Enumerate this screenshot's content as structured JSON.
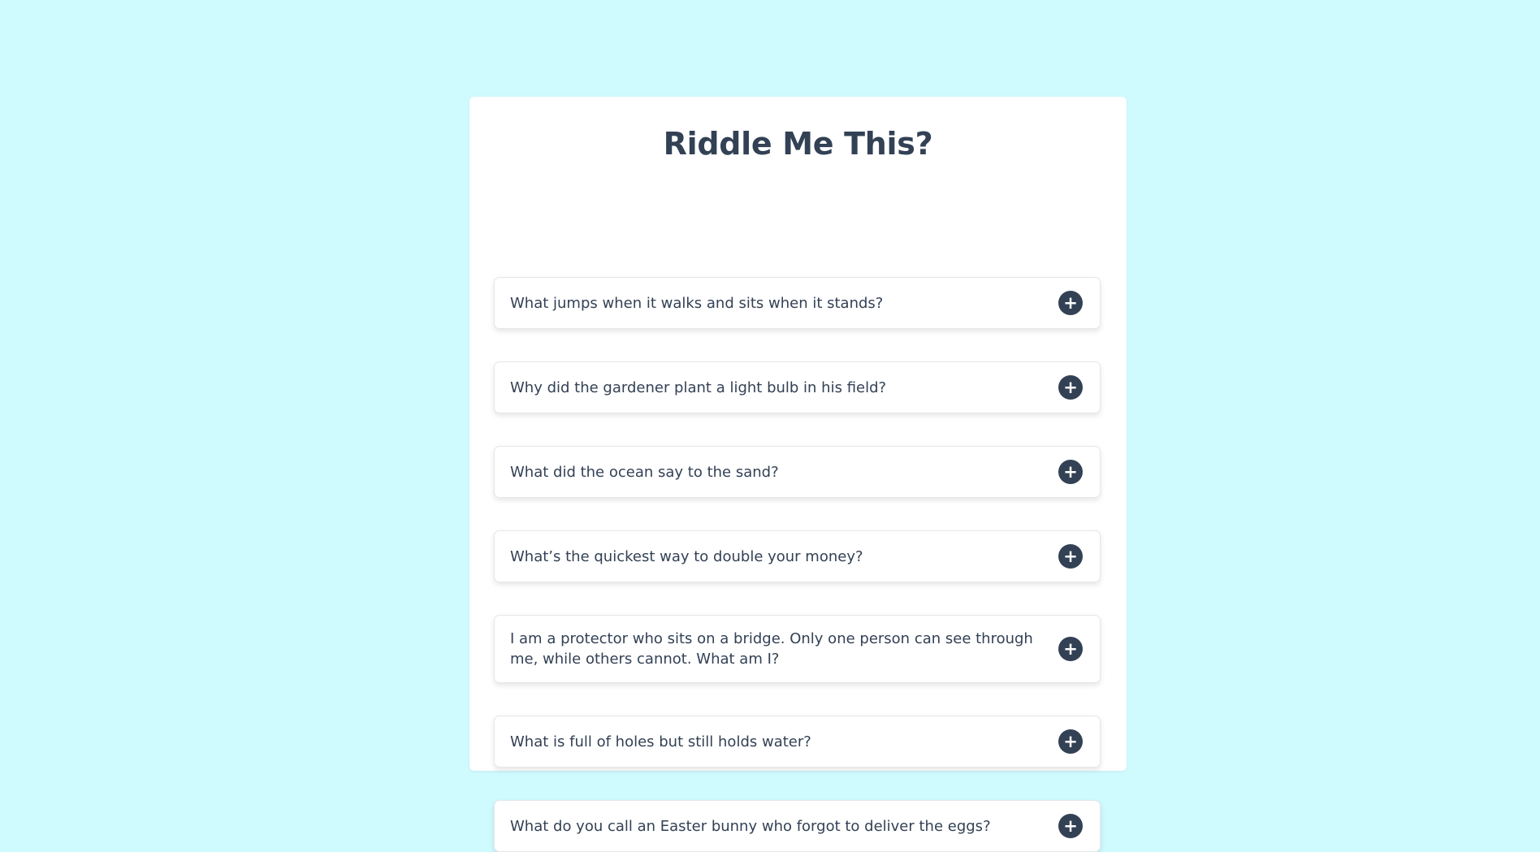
{
  "title": "Riddle Me This?",
  "colors": {
    "background": "#cffafe",
    "card": "#ffffff",
    "text": "#334155",
    "toggle": "#334155"
  },
  "faqs": [
    {
      "question": "What jumps when it walks and sits when it stands?",
      "toggle_icon": "plus-icon",
      "toggle_symbol": "+"
    },
    {
      "question": "Why did the gardener plant a light bulb in his field?",
      "toggle_icon": "plus-icon",
      "toggle_symbol": "+"
    },
    {
      "question": "What did the ocean say to the sand?",
      "toggle_icon": "plus-icon",
      "toggle_symbol": "+"
    },
    {
      "question": "What’s the quickest way to double your money?",
      "toggle_icon": "plus-icon",
      "toggle_symbol": "+"
    },
    {
      "question": "I am a protector who sits on a bridge. Only one person can see through me, while others cannot. What am I?",
      "toggle_icon": "plus-icon",
      "toggle_symbol": "+"
    },
    {
      "question": "What is full of holes but still holds water?",
      "toggle_icon": "plus-icon",
      "toggle_symbol": "+"
    },
    {
      "question": "What do you call an Easter bunny who forgot to deliver the eggs?",
      "toggle_icon": "plus-icon",
      "toggle_symbol": "+"
    }
  ]
}
